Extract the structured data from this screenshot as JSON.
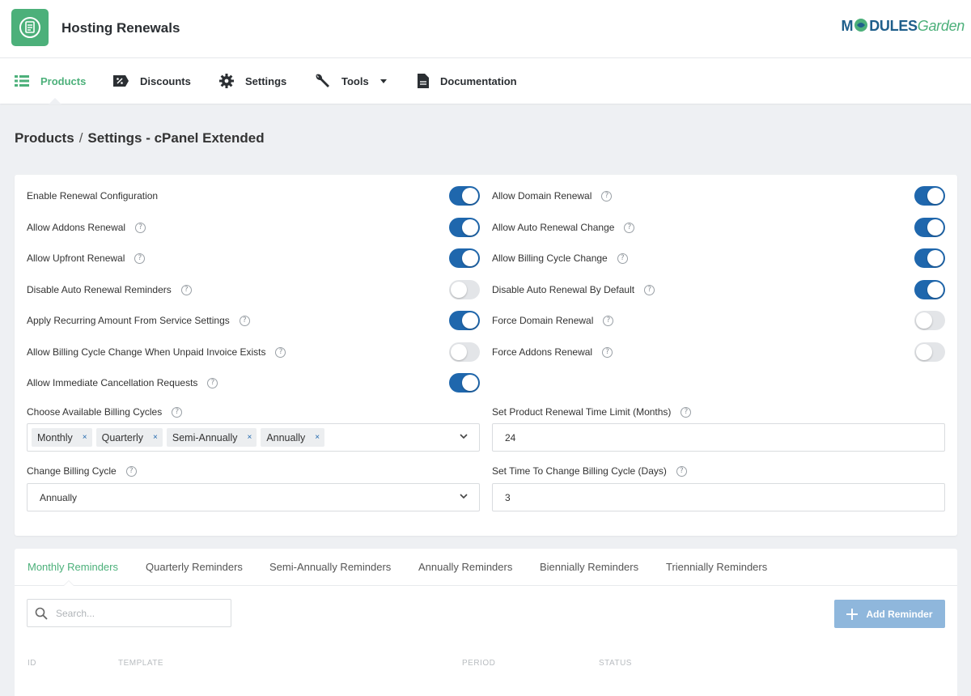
{
  "header": {
    "app_title": "Hosting Renewals",
    "brand_part1": "M",
    "brand_part2": "DULES",
    "brand_part3": "Garden"
  },
  "nav": {
    "items": [
      {
        "label": "Products",
        "icon": "list-icon",
        "active": true
      },
      {
        "label": "Discounts",
        "icon": "discount-icon"
      },
      {
        "label": "Settings",
        "icon": "gear-icon"
      },
      {
        "label": "Tools",
        "icon": "wrench-icon"
      },
      {
        "label": "Documentation",
        "icon": "document-icon"
      }
    ]
  },
  "breadcrumb": {
    "root": "Products",
    "separator": "/",
    "current": "Settings - cPanel Extended"
  },
  "settings": {
    "left": [
      {
        "label": "Enable Renewal Configuration",
        "help": false,
        "on": true
      },
      {
        "label": "Allow Addons Renewal",
        "help": true,
        "on": true
      },
      {
        "label": "Allow Upfront Renewal",
        "help": true,
        "on": true
      },
      {
        "label": "Disable Auto Renewal Reminders",
        "help": true,
        "on": false
      },
      {
        "label": "Apply Recurring Amount From Service Settings",
        "help": true,
        "on": true
      },
      {
        "label": "Allow Billing Cycle Change When Unpaid Invoice Exists",
        "help": true,
        "on": false
      },
      {
        "label": "Allow Immediate Cancellation Requests",
        "help": true,
        "on": true
      }
    ],
    "right": [
      {
        "label": "Allow Domain Renewal",
        "help": true,
        "on": true
      },
      {
        "label": "Allow Auto Renewal Change",
        "help": true,
        "on": true
      },
      {
        "label": "Allow Billing Cycle Change",
        "help": true,
        "on": true
      },
      {
        "label": "Disable Auto Renewal By Default",
        "help": true,
        "on": true
      },
      {
        "label": "Force Domain Renewal",
        "help": true,
        "on": false
      },
      {
        "label": "Force Addons Renewal",
        "help": true,
        "on": false
      }
    ],
    "help_glyph": "?",
    "billing_cycles": {
      "label": "Choose Available Billing Cycles",
      "tags": [
        "Monthly",
        "Quarterly",
        "Semi-Annually",
        "Annually"
      ],
      "remove_glyph": "×"
    },
    "change_cycle": {
      "label": "Change Billing Cycle",
      "value": "Annually"
    },
    "time_limit": {
      "label": "Set Product Renewal Time Limit (Months)",
      "value": "24"
    },
    "time_change": {
      "label": "Set Time To Change Billing Cycle (Days)",
      "value": "3"
    }
  },
  "reminders": {
    "tabs": [
      "Monthly Reminders",
      "Quarterly Reminders",
      "Semi-Annually Reminders",
      "Annually Reminders",
      "Biennially Reminders",
      "Triennially Reminders"
    ],
    "search_placeholder": "Search...",
    "add_label": "Add Reminder",
    "columns": [
      "ID",
      "TEMPLATE",
      "PERIOD",
      "STATUS"
    ]
  },
  "colors": {
    "accent_green": "#4cb07a",
    "toggle_on": "#1f67ad",
    "toggle_off": "#e3e5e8",
    "button_disabled": "#8fb7dc"
  }
}
